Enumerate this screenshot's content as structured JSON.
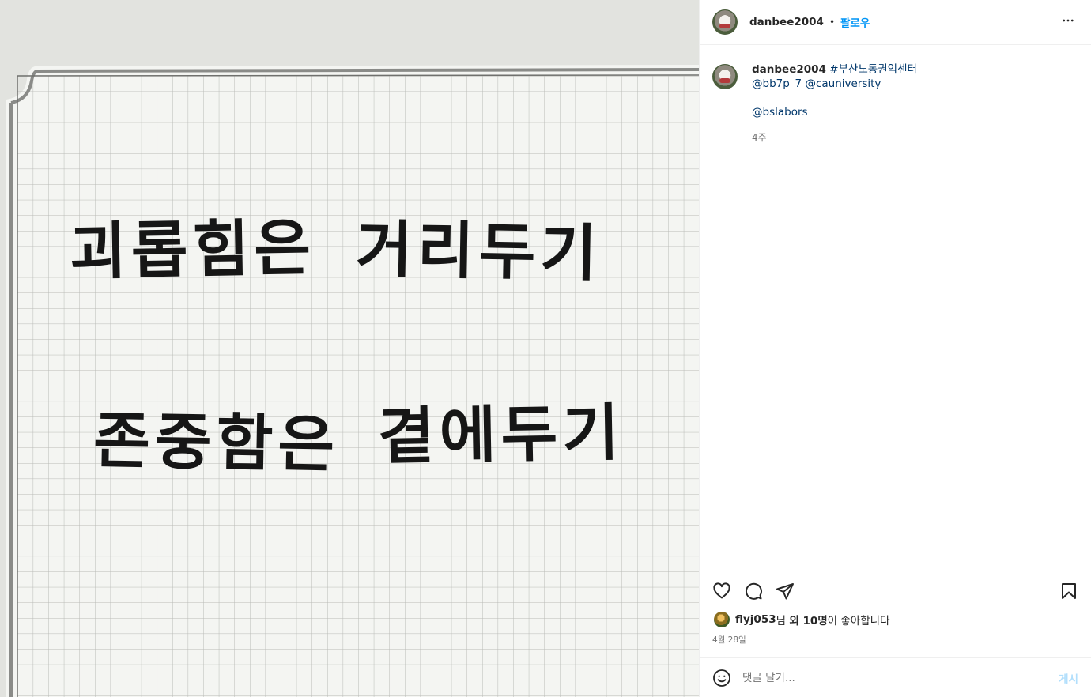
{
  "photo": {
    "line1_left": "괴롭힘은",
    "line1_right": "거리두기",
    "line2_left": "존중함은",
    "line2_right": "곁에두기"
  },
  "header": {
    "username": "danbee2004",
    "separator": "•",
    "follow_label": "팔로우",
    "more_icon": "more-horizontal-icon"
  },
  "caption": {
    "username": "danbee2004",
    "hashtag": "#부산노동권익센터",
    "mention_1": "@bb7p_7",
    "mention_2": "@cauniversity",
    "mention_3": "@bslabors",
    "time_ago": "4주"
  },
  "actions": {
    "icons": [
      "heart-icon",
      "comment-icon",
      "share-icon",
      "bookmark-icon"
    ]
  },
  "likes": {
    "user": "flyj053",
    "suffix_1": "님",
    "and_others": "외 10명",
    "suffix_2": "이 좋아합니다"
  },
  "date": "4월 28일",
  "comment_box": {
    "placeholder": "댓글 달기...",
    "post_label": "게시"
  },
  "colors": {
    "link_blue": "#0095f6",
    "mention_blue": "#00376b",
    "muted": "#737373",
    "post_disabled": "#b2dffc"
  }
}
